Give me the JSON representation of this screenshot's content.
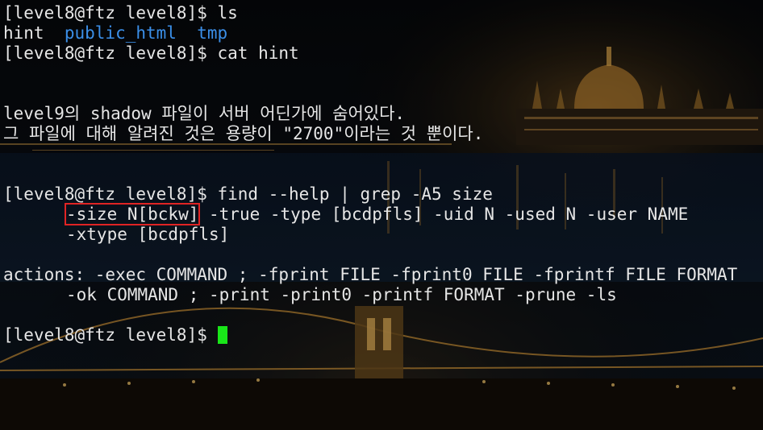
{
  "background": {
    "scene": "night-city-bridge-parliament",
    "colors": {
      "sky": "#07090d",
      "glow": "#e3b04a",
      "water": "#0b1524",
      "lights": "#f4c870"
    }
  },
  "terminal": {
    "lines": {
      "l1": "[level8@ftz level8]$ ls",
      "l2_a": "hint  ",
      "l2_b": "public_html",
      "l2_c": "  ",
      "l2_d": "tmp",
      "l3": "[level8@ftz level8]$ cat hint",
      "l4": "level9의 shadow 파일이 서버 어딘가에 숨어있다.",
      "l5": "그 파일에 대해 알려진 것은 용량이 \"2700\"이라는 것 뿐이다.",
      "l6": "[level8@ftz level8]$ find --help | grep -A5 size",
      "l7_hl": "-size N[bckw]",
      "l7_rest": " -true -type [bcdpfls] -uid N -used N -user NAME",
      "l8": "-xtype [bcdpfls]",
      "l9": "actions: -exec COMMAND ; -fprint FILE -fprint0 FILE -fprintf FILE FORMAT",
      "l10": "-ok COMMAND ; -print -print0 -printf FORMAT -prune -ls",
      "l11": "[level8@ftz level8]$ "
    },
    "colors": {
      "text": "#e6e6e6",
      "directory": "#3b8fe8",
      "highlight_box": "#e02424",
      "cursor": "#19e619"
    }
  }
}
